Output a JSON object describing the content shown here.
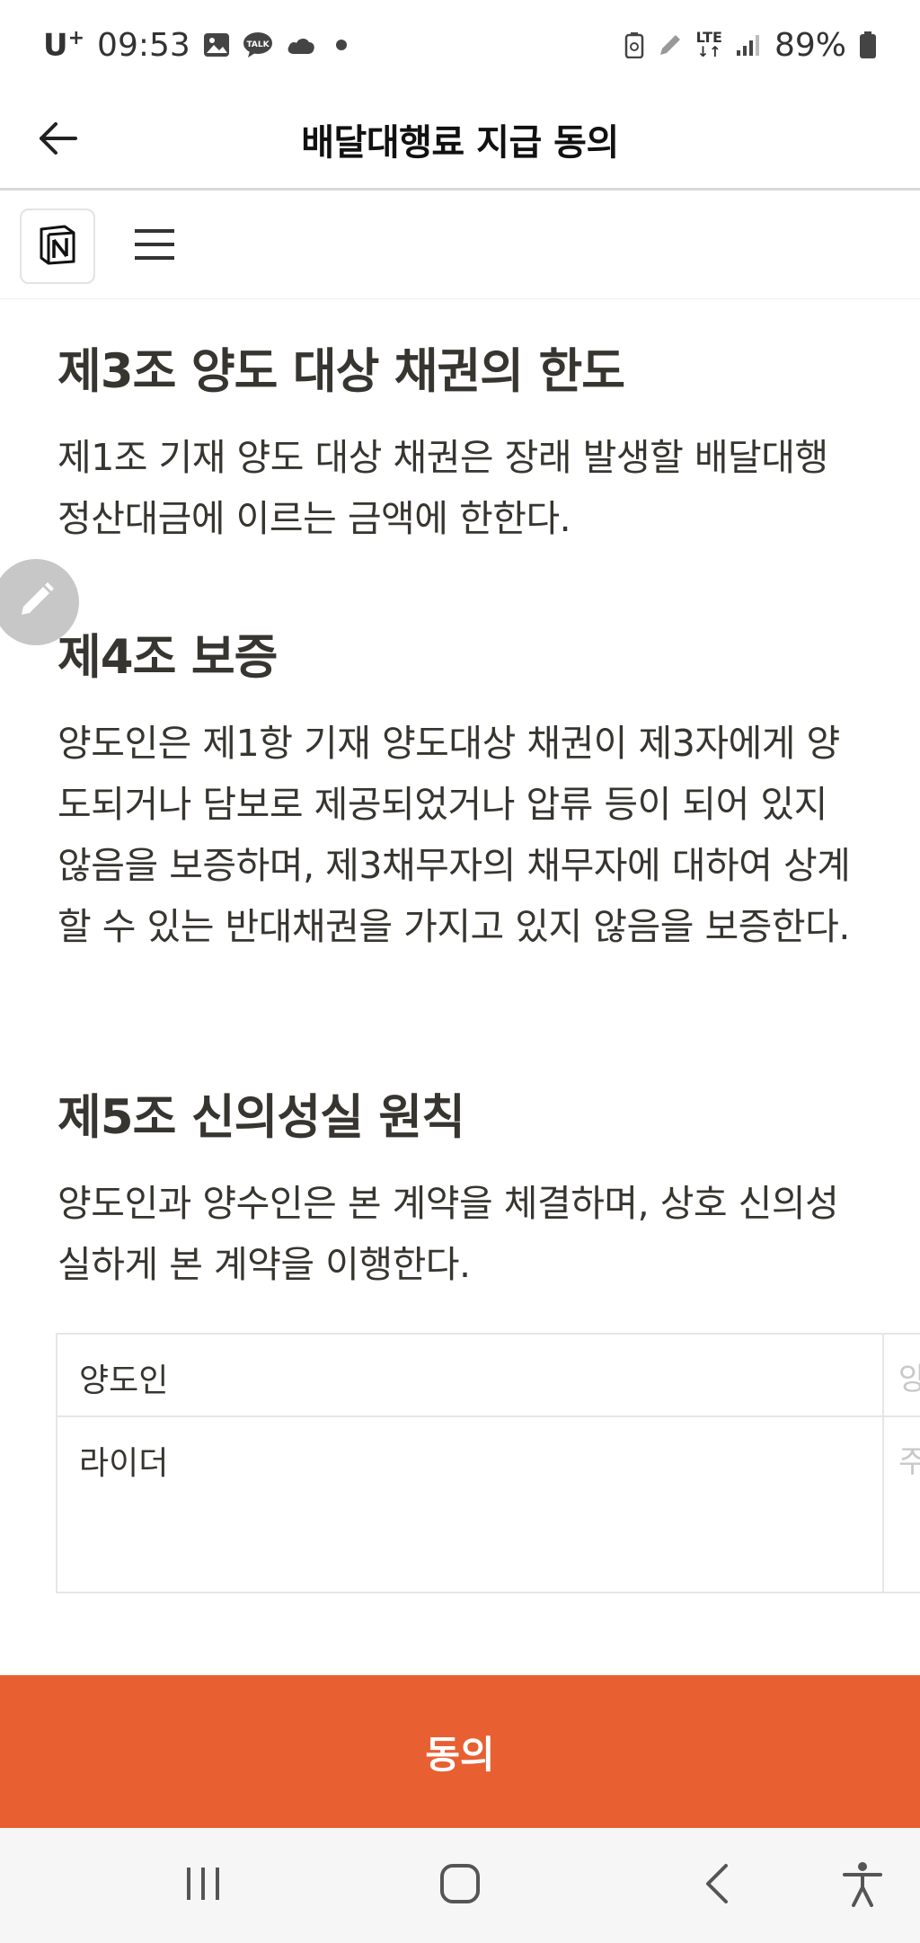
{
  "status_bar": {
    "carrier": "U",
    "carrier_sup": "+",
    "time": "09:53",
    "network": "LTE",
    "battery": "89%"
  },
  "header": {
    "title": "배달대행료 지급 동의"
  },
  "articles": [
    {
      "heading": "제3조 양도 대상 채권의 한도",
      "body": "제1조 기재 양도 대상 채권은 장래 발생할 배달대행 정산대금에 이르는 금액에 한한다."
    },
    {
      "heading": "제4조 보증",
      "body": "양도인은 제1항 기재 양도대상 채권이 제3자에게 양도되거나 담보로 제공되었거나 압류 등이 되어 있지 않음을 보증하며, 제3채무자의 채무자에 대하여 상계할 수 있는 반대채권을 가지고 있지 않음을 보증한다."
    },
    {
      "heading": "제5조 신의성실 원칙",
      "body": "양도인과 양수인은 본 계약을 체결하며, 상호 신의성실하게 본 계약을 이행한다."
    }
  ],
  "table": {
    "rows": [
      {
        "col1": "양도인",
        "col2_partial": "양"
      },
      {
        "col1": "라이더",
        "col2_partial": "주"
      }
    ]
  },
  "agree_button": {
    "label": "동의"
  },
  "colors": {
    "accent": "#e85f32",
    "text": "#37352f",
    "nav_bg": "#f6f6f6"
  },
  "icons": [
    "back-arrow-icon",
    "notion-logo-icon",
    "hamburger-menu-icon",
    "pencil-icon",
    "recent-apps-icon",
    "home-icon",
    "nav-back-icon",
    "accessibility-icon"
  ]
}
